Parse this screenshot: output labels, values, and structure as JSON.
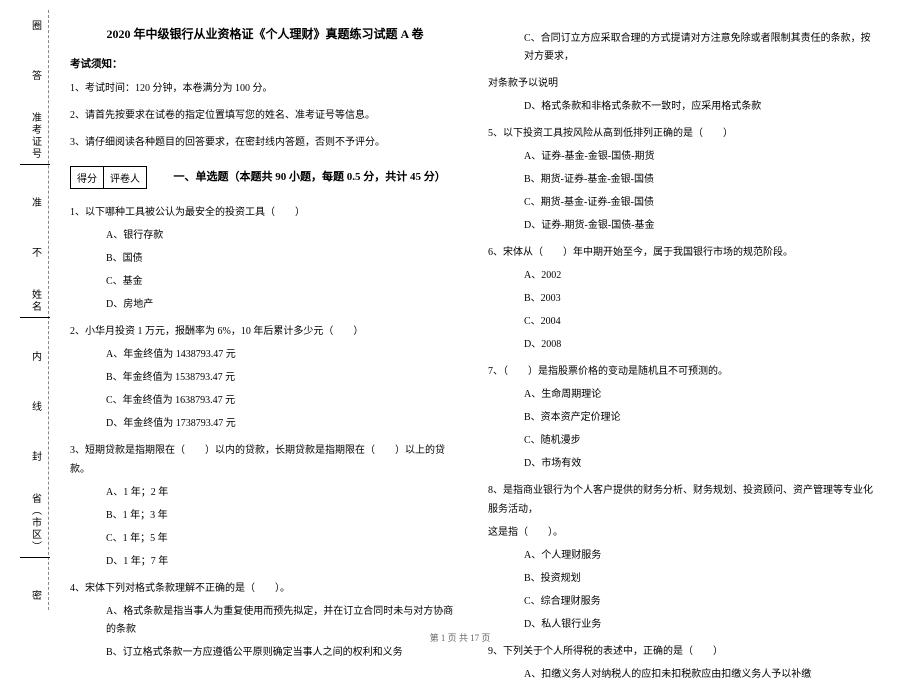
{
  "binding": {
    "circle": "圈",
    "answer": "答",
    "exam_no_label": "准考证号",
    "zhun": "准",
    "bu": "不",
    "name_label": "姓名",
    "nei": "内",
    "xian": "线",
    "feng": "封",
    "province_label": "省（市区）",
    "mi": "密"
  },
  "left": {
    "title": "2020 年中级银行从业资格证《个人理财》真题练习试题 A 卷",
    "notice_label": "考试须知：",
    "instructions": [
      "1、考试时间：120 分钟，本卷满分为 100 分。",
      "2、请首先按要求在试卷的指定位置填写您的姓名、准考证号等信息。",
      "3、请仔细阅读各种题目的回答要求，在密封线内答题，否则不予评分。"
    ],
    "score_labels": {
      "score": "得分",
      "grader": "评卷人"
    },
    "part_title": "一、单选题（本题共 90 小题，每题 0.5 分，共计 45 分）",
    "q1": {
      "stem": "1、以下哪种工具被公认为最安全的投资工具（　　）",
      "opts": [
        "A、银行存款",
        "B、国债",
        "C、基金",
        "D、房地产"
      ]
    },
    "q2": {
      "stem": "2、小华月投资 1 万元，报酬率为 6%，10 年后累计多少元（　　）",
      "opts": [
        "A、年金终值为 1438793.47 元",
        "B、年金终值为 1538793.47 元",
        "C、年金终值为 1638793.47 元",
        "D、年金终值为 1738793.47 元"
      ]
    },
    "q3": {
      "stem": "3、短期贷款是指期限在（　　）以内的贷款，长期贷款是指期限在（　　）以上的贷款。",
      "opts": [
        "A、1 年；2 年",
        "B、1 年；3 年",
        "C、1 年；5 年",
        "D、1 年；7 年"
      ]
    },
    "q4": {
      "stem": "4、宋体下列对格式条款理解不正确的是（　　）。",
      "opts": [
        "A、格式条款是指当事人为重复使用而预先拟定，并在订立合同时未与对方协商的条款",
        "B、订立格式条款一方应遵循公平原则确定当事人之间的权利和义务"
      ]
    }
  },
  "right": {
    "q4_cont": {
      "optC_line1": "C、合同订立方应采取合理的方式提请对方注意免除或者限制其责任的条款，按对方要求，",
      "optC_line2": "对条款予以说明",
      "optD": "D、格式条款和非格式条款不一致时，应采用格式条款"
    },
    "q5": {
      "stem": "5、以下投资工具按风险从高到低排列正确的是（　　）",
      "opts": [
        "A、证券-基金-金银-国债-期货",
        "B、期货-证券-基金-金银-国债",
        "C、期货-基金-证券-金银-国债",
        "D、证券-期货-金银-国债-基金"
      ]
    },
    "q6": {
      "stem": "6、宋体从（　　）年中期开始至今，属于我国银行市场的规范阶段。",
      "opts": [
        "A、2002",
        "B、2003",
        "C、2004",
        "D、2008"
      ]
    },
    "q7": {
      "stem": "7、（　　）是指股票价格的变动是随机且不可预测的。",
      "opts": [
        "A、生命周期理论",
        "B、资本资产定价理论",
        "C、随机漫步",
        "D、市场有效"
      ]
    },
    "q8": {
      "stem_line1": "8、是指商业银行为个人客户提供的财务分析、财务规划、投资顾问、资产管理等专业化服务活动，",
      "stem_line2": "这是指（　　）。",
      "opts": [
        "A、个人理财服务",
        "B、投资规划",
        "C、综合理财服务",
        "D、私人银行业务"
      ]
    },
    "q9": {
      "stem": "9、下列关于个人所得税的表述中，正确的是（　　）",
      "opts": [
        "A、扣缴义务人对纳税人的应扣未扣税款应由扣缴义务人予以补缴"
      ]
    }
  },
  "footer": "第 1 页 共 17 页"
}
